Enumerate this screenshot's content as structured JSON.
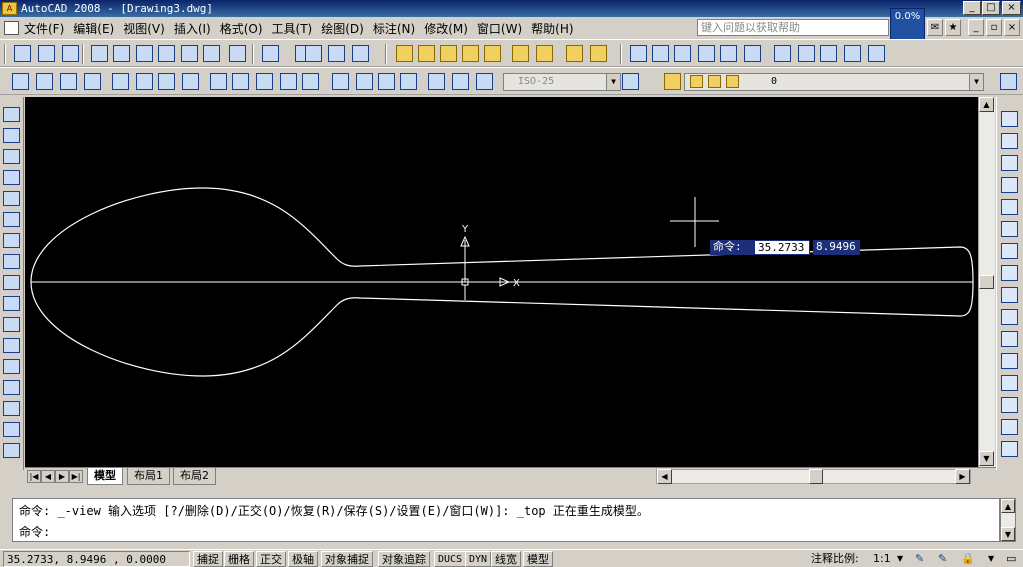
{
  "window": {
    "title": "AutoCAD 2008 - [Drawing3.dwg]",
    "min": "_",
    "max": "□",
    "close": "×"
  },
  "menu": {
    "items": [
      "文件(F)",
      "编辑(E)",
      "视图(V)",
      "插入(I)",
      "格式(O)",
      "工具(T)",
      "绘图(D)",
      "标注(N)",
      "修改(M)",
      "窗口(W)",
      "帮助(H)"
    ],
    "help_placeholder": "键入问题以获取帮助",
    "zoom_tag": "0.0%",
    "doc_min": "_",
    "doc_max": "▫",
    "doc_close": "×"
  },
  "toolbar2": {
    "dimstyle": "ISO-25",
    "layer": "0"
  },
  "canvas": {
    "y_label": "Y",
    "x_label": "X",
    "dyn_prompt": "命令:",
    "dyn_x": "35.2733",
    "dyn_y": "8.9496"
  },
  "tabs": {
    "nav": [
      "|◀",
      "◀",
      "▶",
      "▶|"
    ],
    "items": [
      "模型",
      "布局1",
      "布局2"
    ],
    "active": "模型"
  },
  "command": {
    "history": "命令: _-view 输入选项 [?/删除(D)/正交(O)/恢复(R)/保存(S)/设置(E)/窗口(W)]: _top 正在重生成模型。",
    "prompt": "命令:"
  },
  "status": {
    "coords": "35.2733, 8.9496 , 0.0000",
    "toggles": [
      "捕捉",
      "栅格",
      "正交",
      "极轴",
      "对象捕捉",
      "对象追踪",
      "DUCS",
      "DYN",
      "线宽",
      "模型"
    ],
    "annotation_scale_label": "注释比例:",
    "annotation_scale": "1:1"
  },
  "colors": {
    "canvas_bg": "#000000",
    "geometry": "#ffffff",
    "dyn_box": "#1c2f78",
    "chrome": "#d4d0c8"
  },
  "icons": {
    "toolbar1": [
      "new-icon",
      "open-icon",
      "save-icon",
      "plot-icon",
      "preview-icon",
      "publish-icon",
      "cut-icon",
      "copy-icon",
      "paste-icon",
      "matchprop-icon",
      "undo-icon",
      "redo-icon",
      "pan-icon",
      "calculator-icon",
      "properties-icon",
      "zoom-realtime-icon",
      "zoom-window-icon",
      "zoom-previous-icon",
      "zoom-extents-icon",
      "zoom-icon",
      "zoom-in-icon",
      "zoom-out-icon",
      "zoom-all-icon",
      "zoom-scale-icon",
      "view-top-icon",
      "view-bottom-icon",
      "view-left-icon",
      "view-right-icon",
      "view-front-icon",
      "view-back-icon",
      "view-iso-sw-icon",
      "view-iso-se-icon",
      "view-iso-ne-icon",
      "view-iso-nw-icon",
      "camera-icon"
    ],
    "left_palette": [
      "line-icon",
      "construction-line-icon",
      "polyline-icon",
      "polygon-icon",
      "rectangle-icon",
      "arc-icon",
      "circle-icon",
      "revcloud-icon",
      "spline-icon",
      "ellipse-icon",
      "ellipse-arc-icon",
      "insert-block-icon",
      "make-block-icon",
      "point-icon",
      "hatch-icon",
      "gradient-icon",
      "region-icon"
    ],
    "right_palette": [
      "erase-icon",
      "copy-object-icon",
      "mirror-icon",
      "offset-icon",
      "array-icon",
      "move-icon",
      "rotate-icon",
      "scale-icon",
      "stretch-icon",
      "trim-icon",
      "extend-icon",
      "break-icon",
      "join-icon",
      "chamfer-icon",
      "fillet-icon",
      "explode-icon"
    ]
  }
}
